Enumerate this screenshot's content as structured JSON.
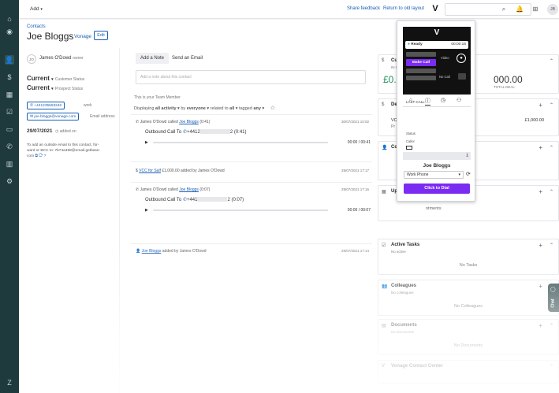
{
  "topbar": {
    "add_label": "Add",
    "share_feedback": "Share feedback",
    "return_old": "Return to old layout",
    "user_initials": "JB"
  },
  "contact": {
    "breadcrumb": "Contacts",
    "name": "Joe Bloggs",
    "company": "Vonage",
    "edit_label": "Edit",
    "owner_initials": "JO",
    "owner_name": "James O'Dowd",
    "owner_label": "owner",
    "customer_status": "Current",
    "customer_status_label": "Customer Status",
    "prospect_status": "Current",
    "prospect_status_label": "Prospect Status",
    "phone": "+441235553240",
    "phone_label": "work",
    "email": "joe.bloggs@vonage.com",
    "email_label": "Email address",
    "added_date": "29/07/2021",
    "added_label": "added on",
    "bcc_text_1": "To add an outside email to this contact, for-",
    "bcc_text_2": "ward or BCC to: 7b74a499@email.getbase-",
    "bcc_text_3": "com"
  },
  "activity": {
    "tab_note": "Add a Note",
    "tab_email": "Send an Email",
    "note_placeholder": "Add a note about this contact",
    "team_note": "This is your Team Member",
    "filter_prefix": "Displaying",
    "filter_all": "all activity",
    "filter_by": "by",
    "filter_everyone": "everyone",
    "filter_related": "related to",
    "filter_all2": "all",
    "filter_tagged": "tagged",
    "filter_any": "any",
    "items": [
      {
        "header": "James O'Dowd called",
        "who": "Joe Bloggs",
        "dur": "(0:41)",
        "date": "30/07/2021 10:02",
        "body_prefix": "Outbound Call To",
        "phone_start": "+4412",
        "phone_end": "2 (0:41)",
        "time": "00:00 / 00:41"
      },
      {
        "header_link": "VCC for Salf",
        "header_rest": "£1,000.00 added by James O'Dowd",
        "date": "29/07/2021 17:17"
      },
      {
        "header": "James O'Dowd called",
        "who": "Joe Bloggs",
        "dur": "(0:07)",
        "date": "29/07/2021 17:16",
        "body_prefix": "Outbound Call To",
        "phone_start": "+441",
        "phone_end": "2 (0:07)",
        "time": "00:00 / 00:07"
      },
      {
        "who": "Joe Bloggs",
        "header_rest": "added by James O'Dowd",
        "date": "29/07/2021 17:14"
      }
    ]
  },
  "cards": {
    "deals_title": "Cu",
    "deals_sub": "IN WOR",
    "deals_left_value": "£0.",
    "deals_right_value": "000.00",
    "deals_right_sub": "TOTAL DEAL",
    "de_title": "De",
    "de_row": "VC",
    "de_row_sub": "Pr",
    "de_amount": "£1,000.00",
    "co_title": "Co",
    "up_title": "Up",
    "up_empty": "ntments",
    "tasks_title": "Active Tasks",
    "tasks_sub": "No active",
    "tasks_empty": "No Tasks",
    "colleagues_title": "Colleagues",
    "colleagues_sub": "No colleagues",
    "colleagues_empty": "No Colleagues",
    "documents_title": "Documents",
    "documents_sub": "No documents",
    "documents_empty": "No Documents",
    "vcc_title": "Vonage Contact Center"
  },
  "widget": {
    "status": "Ready",
    "timer": "00:00:16",
    "make_call": "Make Call",
    "video_label": "Video",
    "no_call": "No Call",
    "last_call": "LAST CALL:",
    "status_label": "Status",
    "caller_label": "Caller",
    "contact_name": "Joe Bloggs",
    "phone_type": "Work Phone",
    "dial_button": "Click to Dial"
  },
  "chat": {
    "label": "Chat"
  }
}
